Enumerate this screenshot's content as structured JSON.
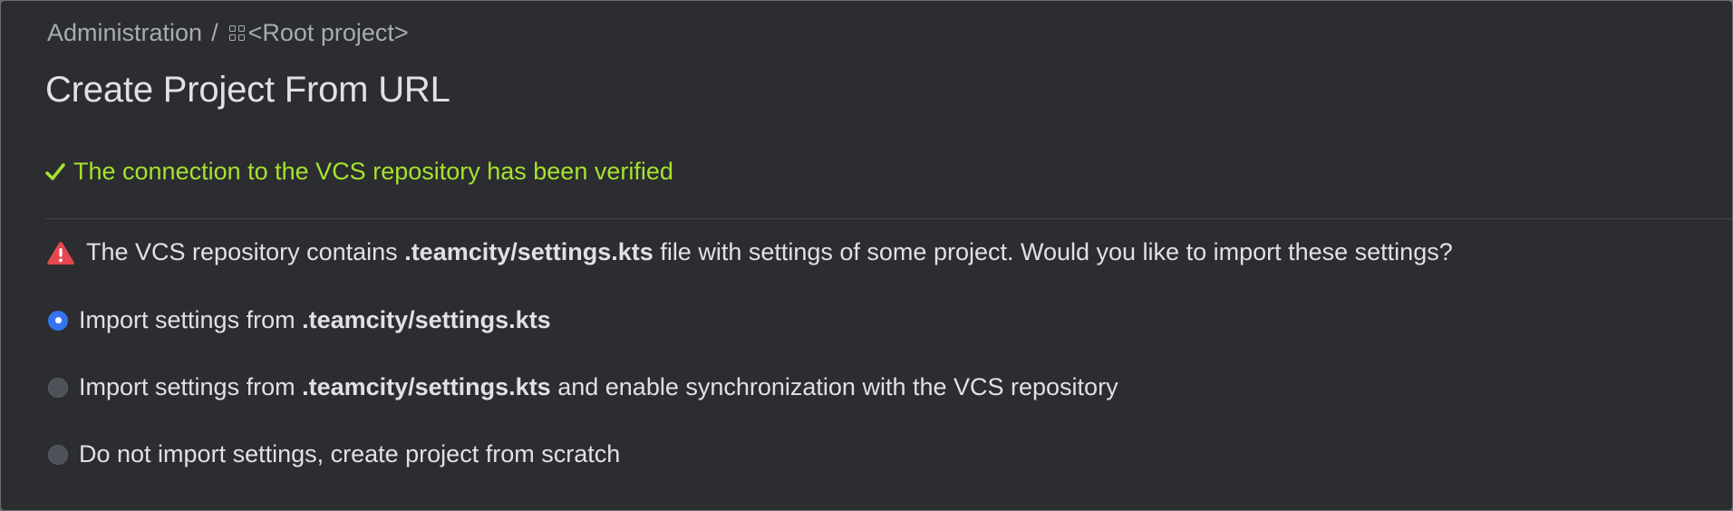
{
  "breadcrumb": {
    "admin": "Administration",
    "separator": "/",
    "project_icon": "project-grid-icon",
    "project": "<Root project>"
  },
  "title": "Create Project From URL",
  "success": {
    "icon": "checkmark-icon",
    "text": "The connection to the VCS repository has been verified",
    "color": "#a6e22e"
  },
  "warning": {
    "icon": "warning-triangle-icon",
    "color": "#e5484d",
    "text_before": "The VCS repository contains",
    "file": ".teamcity/settings.kts",
    "text_after": "file with settings of some project. Would you like to import these settings?"
  },
  "options": [
    {
      "selected": true,
      "text_before": "Import settings from",
      "file": ".teamcity/settings.kts",
      "text_after": ""
    },
    {
      "selected": false,
      "text_before": "Import settings from",
      "file": ".teamcity/settings.kts",
      "text_after": "and enable synchronization with the VCS repository"
    },
    {
      "selected": false,
      "text": "Do not import settings, create project from scratch"
    }
  ],
  "colors": {
    "background": "#2b2d30",
    "accent": "#3574f0"
  }
}
